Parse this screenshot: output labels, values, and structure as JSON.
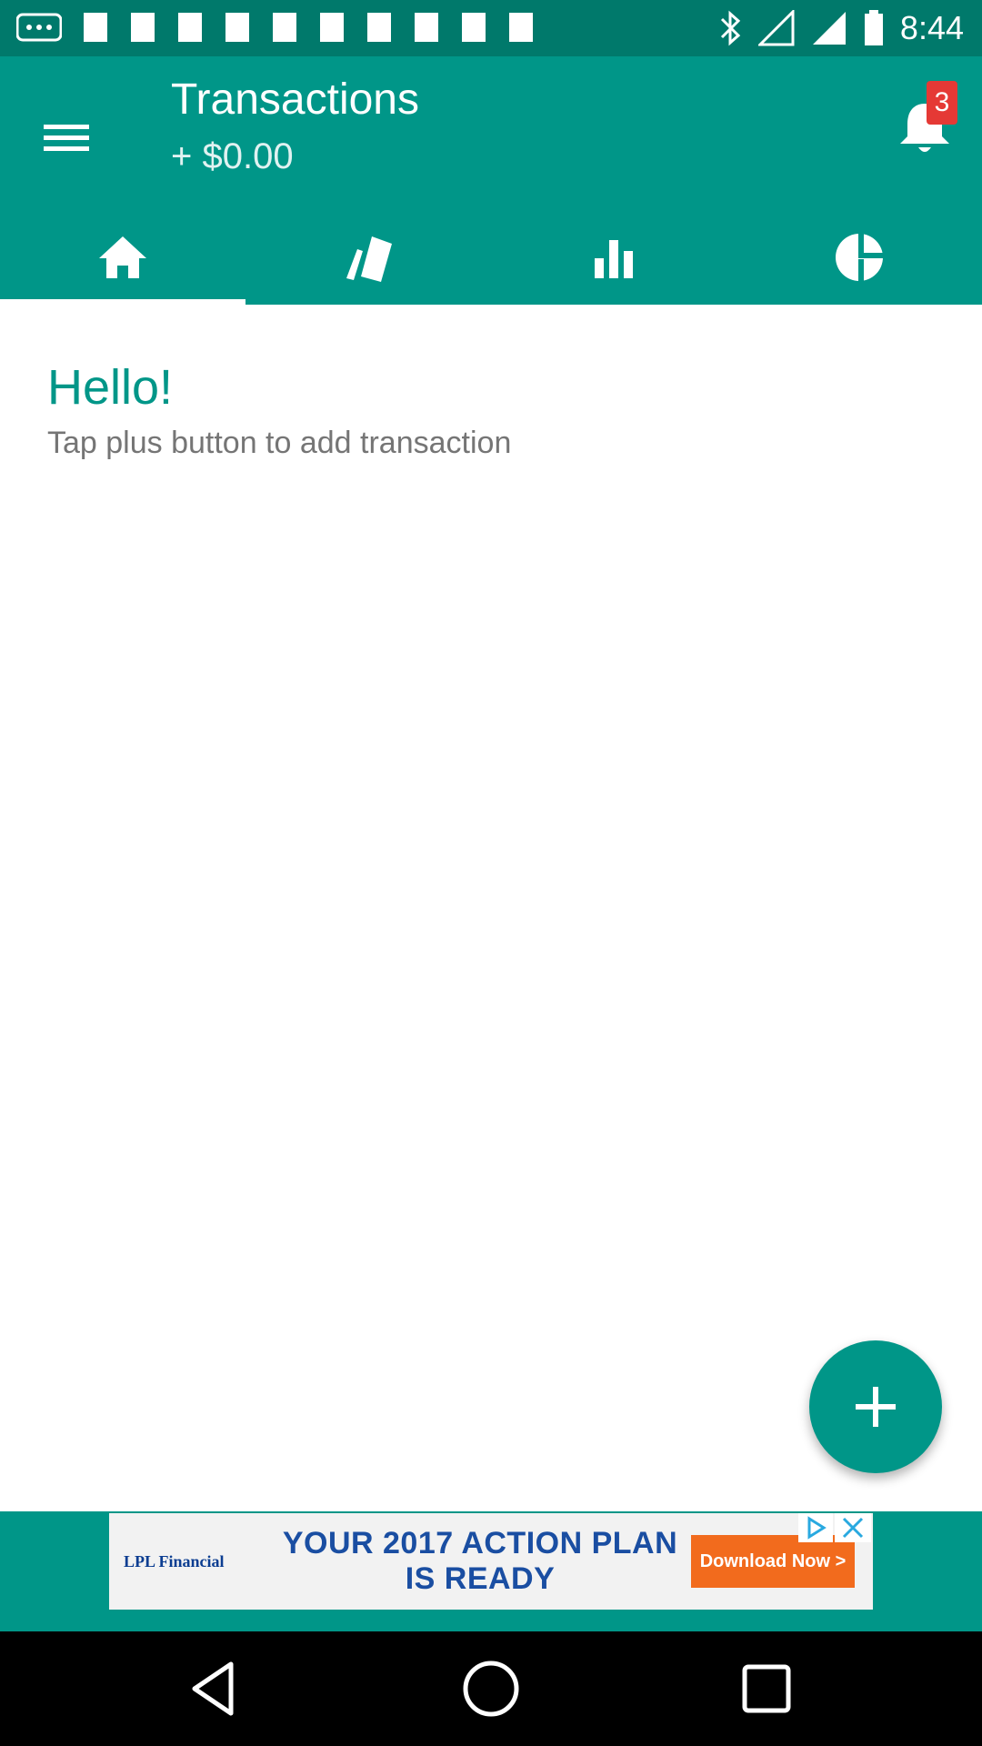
{
  "status_bar": {
    "time": "8:44"
  },
  "app_bar": {
    "title": "Transactions",
    "balance": "+ $0.00",
    "notification_count": "3",
    "tabs": [
      {
        "icon": "home-icon",
        "active": true
      },
      {
        "icon": "cards-icon",
        "active": false
      },
      {
        "icon": "bar-chart-icon",
        "active": false
      },
      {
        "icon": "pie-chart-icon",
        "active": false
      }
    ]
  },
  "main": {
    "greeting": "Hello!",
    "hint": "Tap plus button to add transaction"
  },
  "ad": {
    "brand": "LPL Financial",
    "headline": "YOUR 2017 ACTION PLAN IS READY",
    "cta": "Download Now >"
  },
  "colors": {
    "primary": "#009688",
    "primary_dark": "#00796b",
    "badge": "#e53935",
    "ad_cta": "#f26b1d"
  }
}
